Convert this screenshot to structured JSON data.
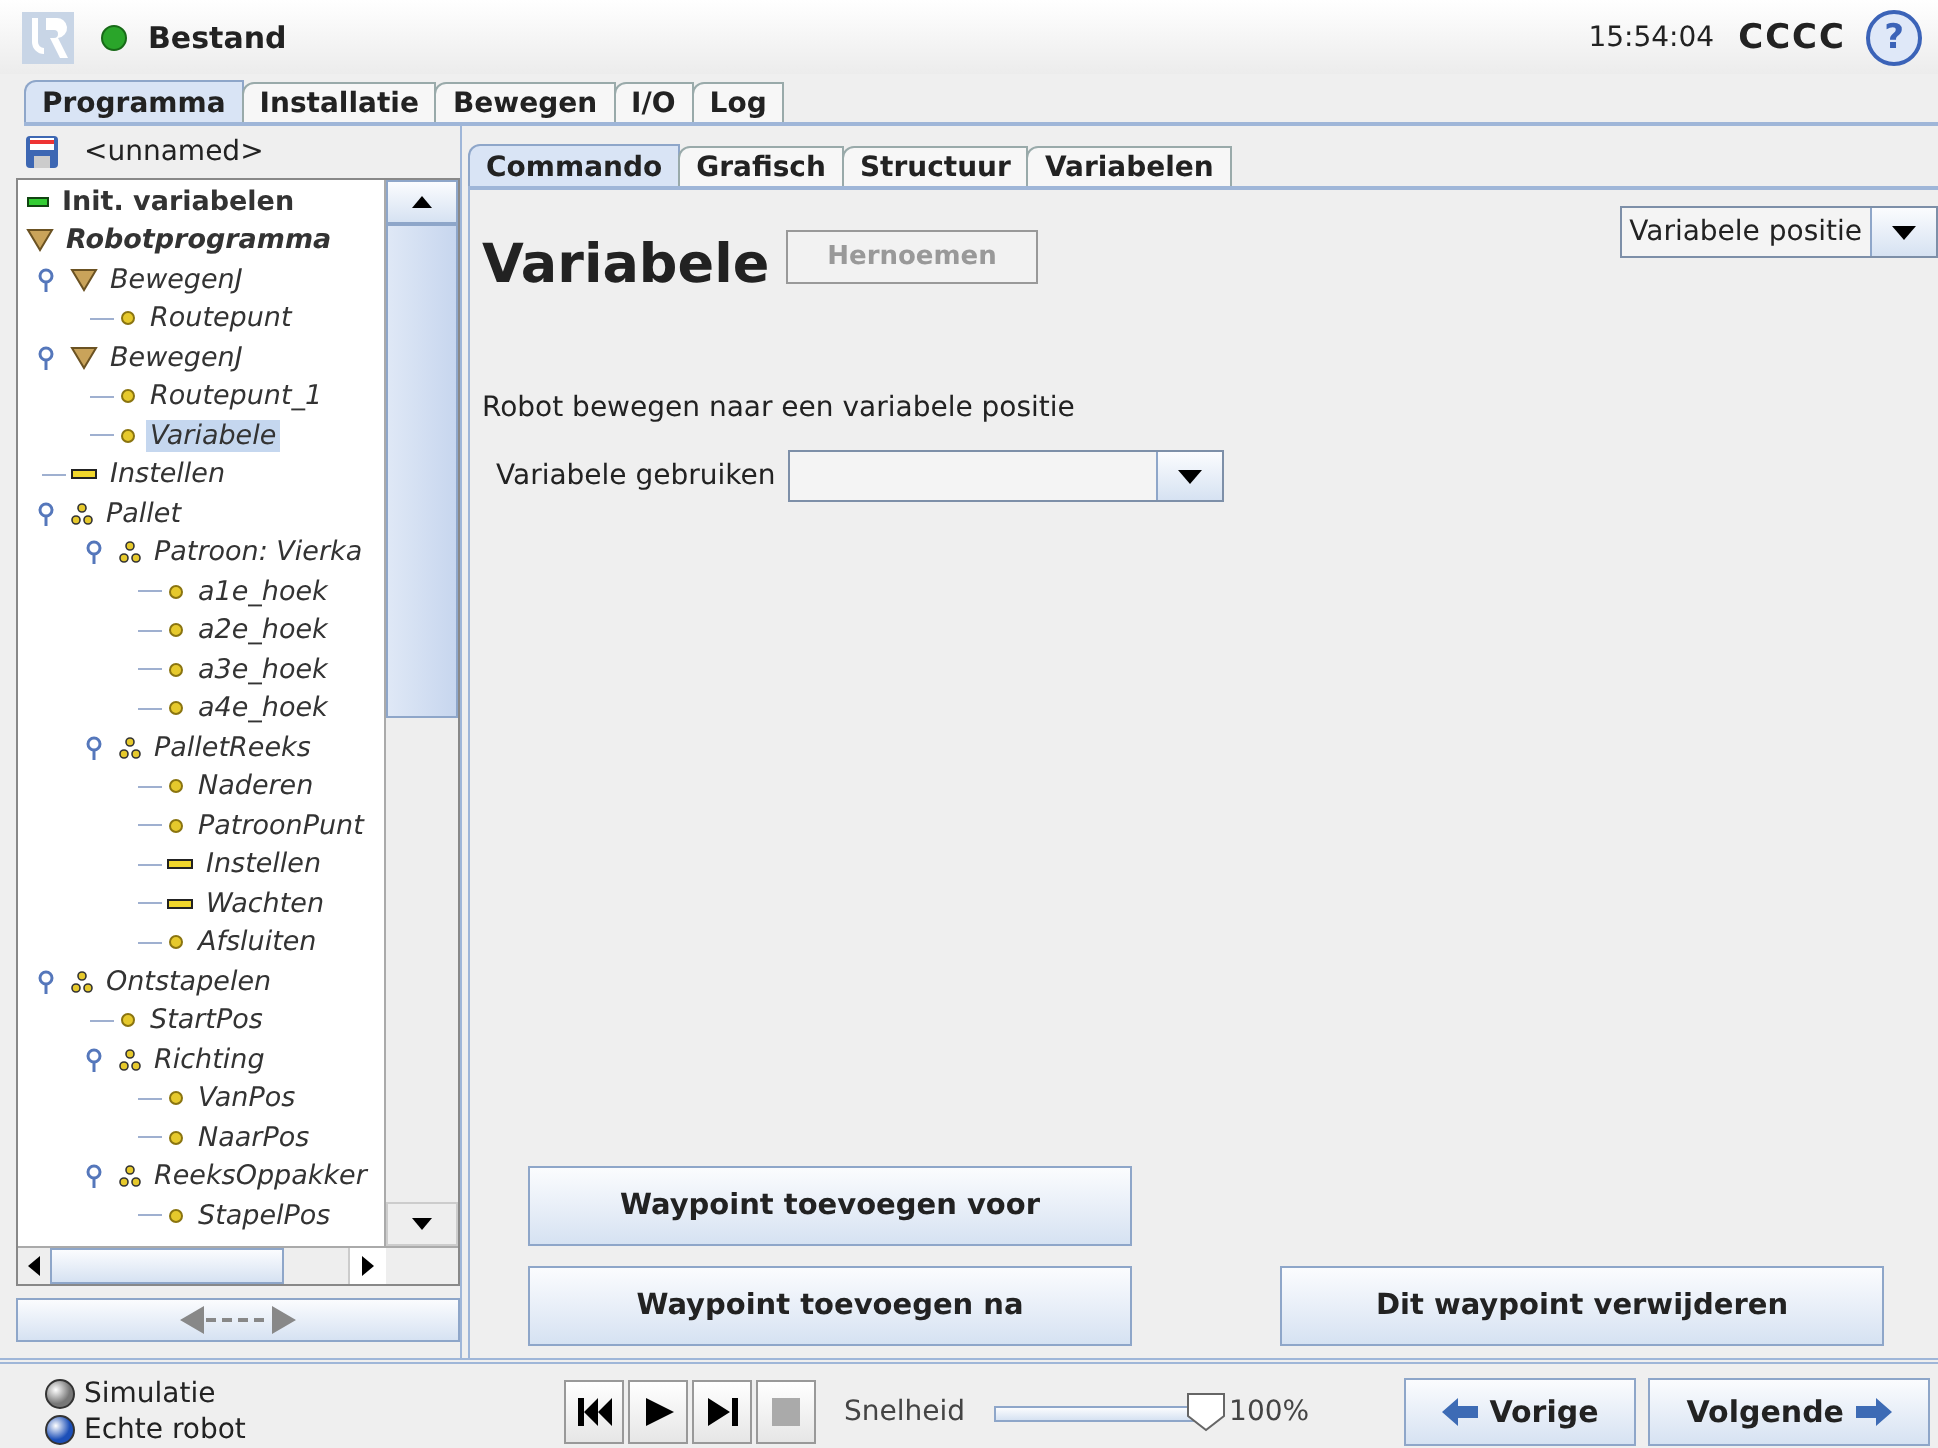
{
  "header": {
    "title": "Bestand",
    "time": "15:54:04",
    "robot_name": "CCCC",
    "help": "?"
  },
  "main_tabs": [
    {
      "label": "Programma",
      "selected": true
    },
    {
      "label": "Installatie",
      "selected": false
    },
    {
      "label": "Bewegen",
      "selected": false
    },
    {
      "label": "I/O",
      "selected": false
    },
    {
      "label": "Log",
      "selected": false
    }
  ],
  "program_name": "<unnamed>",
  "tree": [
    {
      "label": "Init. variabelen",
      "kind": "init",
      "selected": false
    },
    {
      "label": "Robotprogramma",
      "kind": "root",
      "selected": false,
      "children": [
        {
          "label": "BewegenJ",
          "kind": "move",
          "selected": false,
          "children": [
            {
              "label": "Routepunt",
              "kind": "point",
              "selected": false
            }
          ]
        },
        {
          "label": "BewegenJ",
          "kind": "move",
          "selected": false,
          "children": [
            {
              "label": "Routepunt_1",
              "kind": "point",
              "selected": false
            },
            {
              "label": "Variabele",
              "kind": "point",
              "selected": true
            }
          ]
        },
        {
          "label": "Instellen",
          "kind": "set",
          "selected": false
        },
        {
          "label": "Pallet",
          "kind": "pallet",
          "selected": false,
          "children": [
            {
              "label": "Patroon: Vierka",
              "kind": "pallet",
              "selected": false,
              "children": [
                {
                  "label": "a1e_hoek",
                  "kind": "point",
                  "selected": false
                },
                {
                  "label": "a2e_hoek",
                  "kind": "point",
                  "selected": false
                },
                {
                  "label": "a3e_hoek",
                  "kind": "point",
                  "selected": false
                },
                {
                  "label": "a4e_hoek",
                  "kind": "point",
                  "selected": false
                }
              ]
            },
            {
              "label": "PalletReeks",
              "kind": "pallet",
              "selected": false,
              "children": [
                {
                  "label": "Naderen",
                  "kind": "point",
                  "selected": false
                },
                {
                  "label": "PatroonPunt",
                  "kind": "point",
                  "selected": false
                },
                {
                  "label": "Instellen",
                  "kind": "set",
                  "selected": false
                },
                {
                  "label": "Wachten",
                  "kind": "set",
                  "selected": false
                },
                {
                  "label": "Afsluiten",
                  "kind": "point",
                  "selected": false
                }
              ]
            }
          ]
        },
        {
          "label": "Ontstapelen",
          "kind": "pallet",
          "selected": false,
          "children": [
            {
              "label": "StartPos",
              "kind": "point",
              "selected": false
            },
            {
              "label": "Richting",
              "kind": "pallet",
              "selected": false,
              "children": [
                {
                  "label": "VanPos",
                  "kind": "point",
                  "selected": false
                },
                {
                  "label": "NaarPos",
                  "kind": "point",
                  "selected": false
                }
              ]
            },
            {
              "label": "ReeksOppakker",
              "kind": "pallet",
              "selected": false,
              "children": [
                {
                  "label": "StapelPos",
                  "kind": "point",
                  "selected": false
                }
              ]
            }
          ]
        }
      ]
    }
  ],
  "sub_tabs": [
    {
      "label": "Commando",
      "selected": true
    },
    {
      "label": "Grafisch",
      "selected": false
    },
    {
      "label": "Structuur",
      "selected": false
    },
    {
      "label": "Variabelen",
      "selected": false
    }
  ],
  "command": {
    "title": "Variabele",
    "rename_button": {
      "label": "Hernoemen",
      "disabled": true
    },
    "type_dropdown": {
      "value": "Variabele positie"
    },
    "description": "Robot bewegen naar een variabele positie",
    "variable_label": "Variabele gebruiken"
  },
  "buttons": [
    {
      "label": "Waypoint toevoegen voor"
    },
    {
      "label": "Waypoint toevoegen na"
    },
    {
      "label": "Dit waypoint verwijderen"
    }
  ],
  "footer": {
    "modes": [
      {
        "label": "Simulatie",
        "selected": false
      },
      {
        "label": "Echte robot",
        "selected": true
      }
    ],
    "transport": [
      {
        "kind": "rewind",
        "disabled": false
      },
      {
        "kind": "play",
        "disabled": false
      },
      {
        "kind": "step",
        "disabled": false
      },
      {
        "kind": "stop",
        "disabled": true
      }
    ],
    "speed_label": "Snelheid",
    "speed": {
      "level": 1
    },
    "speed_reading": "100%",
    "prev": "Vorige",
    "next": "Volgende"
  }
}
